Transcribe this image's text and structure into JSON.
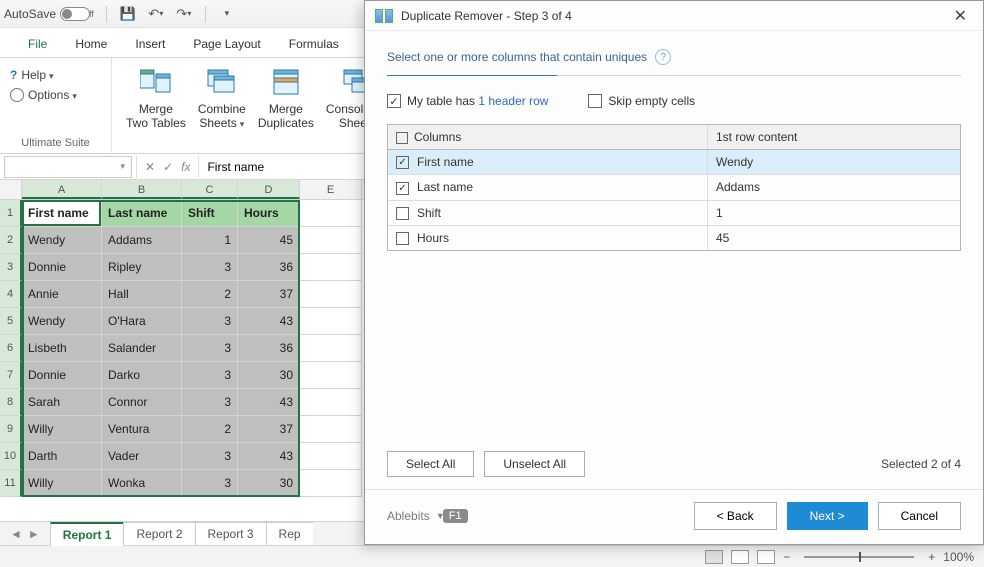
{
  "titlebar": {
    "autosave_label": "AutoSave",
    "autosave_state": "Off"
  },
  "ribbon_tabs": [
    "File",
    "Home",
    "Insert",
    "Page Layout",
    "Formulas"
  ],
  "ribbon": {
    "help": "Help",
    "options": "Options",
    "group_title": "Ultimate Suite",
    "buttons": {
      "merge_two_tables": "Merge\nTwo Tables",
      "combine_sheets": "Combine\nSheets",
      "merge_duplicates": "Merge\nDuplicates",
      "consolidate_sheets": "Consolidate\nSheets"
    }
  },
  "formula_bar": {
    "fx": "fx",
    "value": "First name"
  },
  "columns": [
    "A",
    "B",
    "C",
    "D",
    "E"
  ],
  "headers": [
    "First name",
    "Last name",
    "Shift",
    "Hours"
  ],
  "rows": [
    {
      "first": "Wendy",
      "last": "Addams",
      "shift": "1",
      "hours": "45"
    },
    {
      "first": "Donnie",
      "last": "Ripley",
      "shift": "3",
      "hours": "36"
    },
    {
      "first": "Annie",
      "last": "Hall",
      "shift": "2",
      "hours": "37"
    },
    {
      "first": "Wendy",
      "last": "O'Hara",
      "shift": "3",
      "hours": "43"
    },
    {
      "first": "Lisbeth",
      "last": "Salander",
      "shift": "3",
      "hours": "36"
    },
    {
      "first": "Donnie",
      "last": "Darko",
      "shift": "3",
      "hours": "30"
    },
    {
      "first": "Sarah",
      "last": "Connor",
      "shift": "3",
      "hours": "43"
    },
    {
      "first": "Willy",
      "last": "Ventura",
      "shift": "2",
      "hours": "37"
    },
    {
      "first": "Darth",
      "last": "Vader",
      "shift": "3",
      "hours": "43"
    },
    {
      "first": "Willy",
      "last": "Wonka",
      "shift": "3",
      "hours": "30"
    }
  ],
  "sheet_tabs": [
    "Report 1",
    "Report 2",
    "Report 3",
    "Rep"
  ],
  "active_sheet": 0,
  "statusbar": {
    "zoom": "100%"
  },
  "dialog": {
    "title": "Duplicate Remover - Step 3 of 4",
    "heading": "Select one or more columns that contain uniques",
    "check_header": {
      "prefix": "My table has ",
      "link": "1 header row"
    },
    "check_header_checked": true,
    "skip_empty": "Skip empty cells",
    "skip_empty_checked": false,
    "table": {
      "col1": "Columns",
      "col2": "1st row content",
      "rows": [
        {
          "name": "First name",
          "content": "Wendy",
          "checked": true,
          "selected": true
        },
        {
          "name": "Last name",
          "content": "Addams",
          "checked": true,
          "selected": false
        },
        {
          "name": "Shift",
          "content": "1",
          "checked": false,
          "selected": false
        },
        {
          "name": "Hours",
          "content": "45",
          "checked": false,
          "selected": false
        }
      ]
    },
    "select_all": "Select All",
    "unselect_all": "Unselect All",
    "selected_text": "Selected 2 of 4",
    "brand": "Ablebits",
    "f1": "F1",
    "back": "< Back",
    "next": "Next >",
    "cancel": "Cancel"
  }
}
